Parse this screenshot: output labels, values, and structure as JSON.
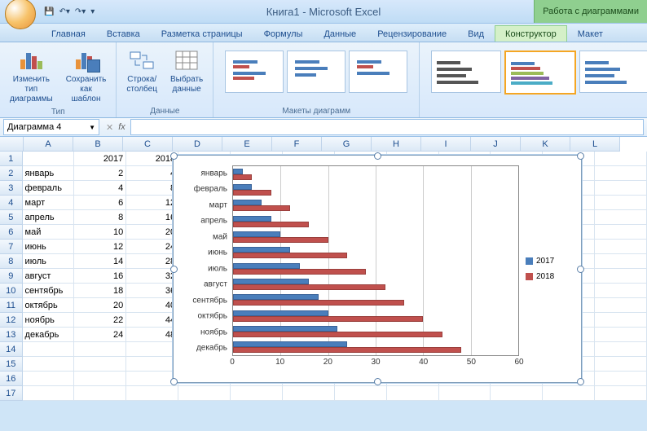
{
  "title": "Книга1 - Microsoft Excel",
  "context_title": "Работа с диаграммами",
  "tabs": [
    "Главная",
    "Вставка",
    "Разметка страницы",
    "Формулы",
    "Данные",
    "Рецензирование",
    "Вид",
    "Конструктор",
    "Макет"
  ],
  "active_tab": 7,
  "ribbon": {
    "type_group": "Тип",
    "change_type": "Изменить тип\nдиаграммы",
    "save_template": "Сохранить\nкак шаблон",
    "data_group": "Данные",
    "switch_rc": "Строка/столбец",
    "select_data": "Выбрать\nданные",
    "layouts_group": "Макеты диаграмм"
  },
  "namebox": "Диаграмма 4",
  "fx": "fx",
  "columns": [
    "A",
    "B",
    "C",
    "D",
    "E",
    "F",
    "G",
    "H",
    "I",
    "J",
    "K",
    "L"
  ],
  "sheet": {
    "header_row": [
      "",
      "2017",
      "2018"
    ],
    "rows": [
      [
        "январь",
        "2",
        "4"
      ],
      [
        "февраль",
        "4",
        "8"
      ],
      [
        "март",
        "6",
        "12"
      ],
      [
        "апрель",
        "8",
        "16"
      ],
      [
        "май",
        "10",
        "20"
      ],
      [
        "июнь",
        "12",
        "24"
      ],
      [
        "июль",
        "14",
        "28"
      ],
      [
        "август",
        "16",
        "32"
      ],
      [
        "сентябрь",
        "18",
        "36"
      ],
      [
        "октябрь",
        "20",
        "40"
      ],
      [
        "ноябрь",
        "22",
        "44"
      ],
      [
        "декабрь",
        "24",
        "48"
      ]
    ]
  },
  "chart_data": {
    "type": "bar",
    "categories": [
      "январь",
      "февраль",
      "март",
      "апрель",
      "май",
      "июнь",
      "июль",
      "август",
      "сентябрь",
      "октябрь",
      "ноябрь",
      "декабрь"
    ],
    "series": [
      {
        "name": "2017",
        "values": [
          2,
          4,
          6,
          8,
          10,
          12,
          14,
          16,
          18,
          20,
          22,
          24
        ],
        "color": "#4a7ebb"
      },
      {
        "name": "2018",
        "values": [
          4,
          8,
          12,
          16,
          20,
          24,
          28,
          32,
          36,
          40,
          44,
          48
        ],
        "color": "#c0504d"
      }
    ],
    "xlim": [
      0,
      60
    ],
    "xticks": [
      0,
      10,
      20,
      30,
      40,
      50,
      60
    ],
    "legend": [
      "2017",
      "2018"
    ]
  }
}
